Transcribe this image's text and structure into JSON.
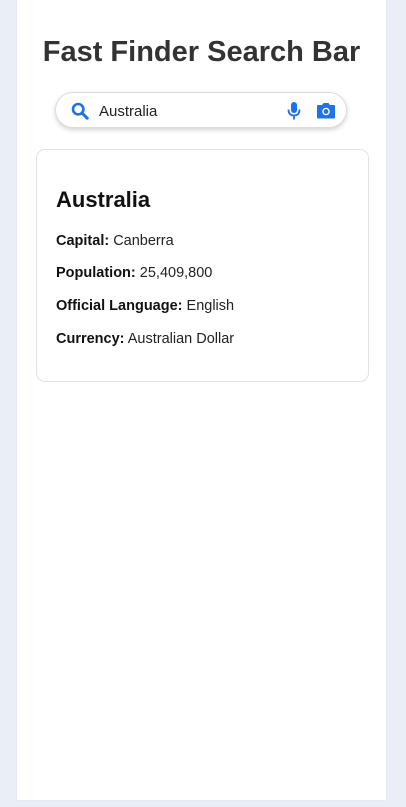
{
  "header": {
    "title": "Fast Finder Search Bar"
  },
  "search": {
    "value": "Australia",
    "icons": {
      "search": "search-icon",
      "mic": "microphone-icon",
      "camera": "camera-icon"
    },
    "accent_color": "#1a73e8"
  },
  "result": {
    "name": "Australia",
    "fields": [
      {
        "label": "Capital:",
        "value": "Canberra"
      },
      {
        "label": "Population:",
        "value": "25,409,800"
      },
      {
        "label": "Official Language:",
        "value": "English"
      },
      {
        "label": "Currency:",
        "value": "Australian Dollar"
      }
    ]
  }
}
